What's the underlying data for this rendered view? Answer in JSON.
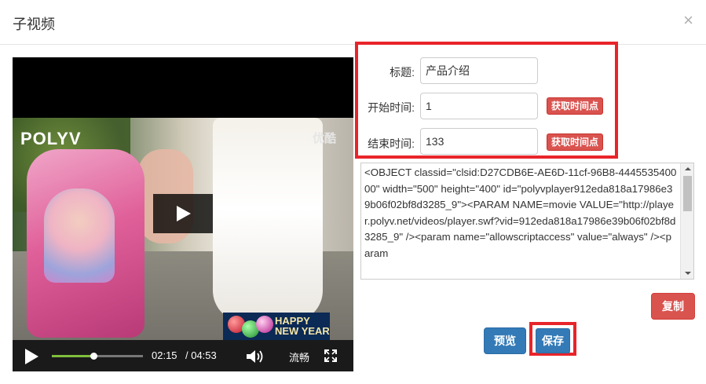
{
  "modal": {
    "title": "子视频",
    "close_symbol": "×"
  },
  "player": {
    "brand_logo": "POLYV",
    "watermark": "优酷",
    "promo_badge_text": "HAPPY NEW YEAR",
    "current_time": "02:15",
    "total_time": "/ 04:53",
    "quality_label": "流畅",
    "progress_fraction": 0.46,
    "icons": [
      "play-icon",
      "volume-icon",
      "fullscreen-icon"
    ]
  },
  "form": {
    "title_label": "标题:",
    "title_value": "产品介绍",
    "start_label": "开始时间:",
    "start_value": "1",
    "end_label": "结束时间:",
    "end_value": "133",
    "get_time_button": "获取时间点"
  },
  "embed_code": "<OBJECT classid=\"clsid:D27CDB6E-AE6D-11cf-96B8-444553540000\" width=\"500\" height=\"400\" id=\"polyvplayer912eda818a17986e39b06f02bf8d3285_9\"><PARAM NAME=movie VALUE=\"http://player.polyv.net/videos/player.swf?vid=912eda818a17986e39b06f02bf8d3285_9\" /><param name=\"allowscriptaccess\" value=\"always\" /><param",
  "buttons": {
    "copy": "复制",
    "preview": "预览",
    "save": "保存"
  },
  "colors": {
    "danger": "#d9534f",
    "primary": "#337ab7",
    "highlight": "#e8242a",
    "progress": "#7fbf3c"
  }
}
